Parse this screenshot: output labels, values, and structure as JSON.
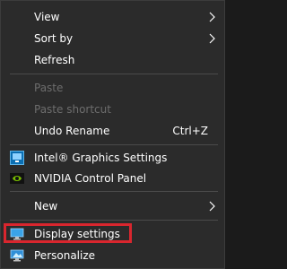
{
  "context_menu": {
    "items": [
      {
        "label": "View",
        "has_submenu": true
      },
      {
        "label": "Sort by",
        "has_submenu": true
      },
      {
        "label": "Refresh"
      },
      {
        "label": "Paste",
        "disabled": true
      },
      {
        "label": "Paste shortcut",
        "disabled": true
      },
      {
        "label": "Undo Rename",
        "shortcut": "Ctrl+Z"
      },
      {
        "label": "Intel® Graphics Settings",
        "icon": "intel-graphics-icon"
      },
      {
        "label": "NVIDIA Control Panel",
        "icon": "nvidia-icon"
      },
      {
        "label": "New",
        "has_submenu": true
      },
      {
        "label": "Display settings",
        "icon": "display-settings-icon"
      },
      {
        "label": "Personalize",
        "icon": "personalize-icon"
      }
    ]
  },
  "colors": {
    "menu_background": "#2b2b2b",
    "text": "#ffffff",
    "disabled_text": "#6d6d6d",
    "highlight_border": "#d9262e"
  }
}
